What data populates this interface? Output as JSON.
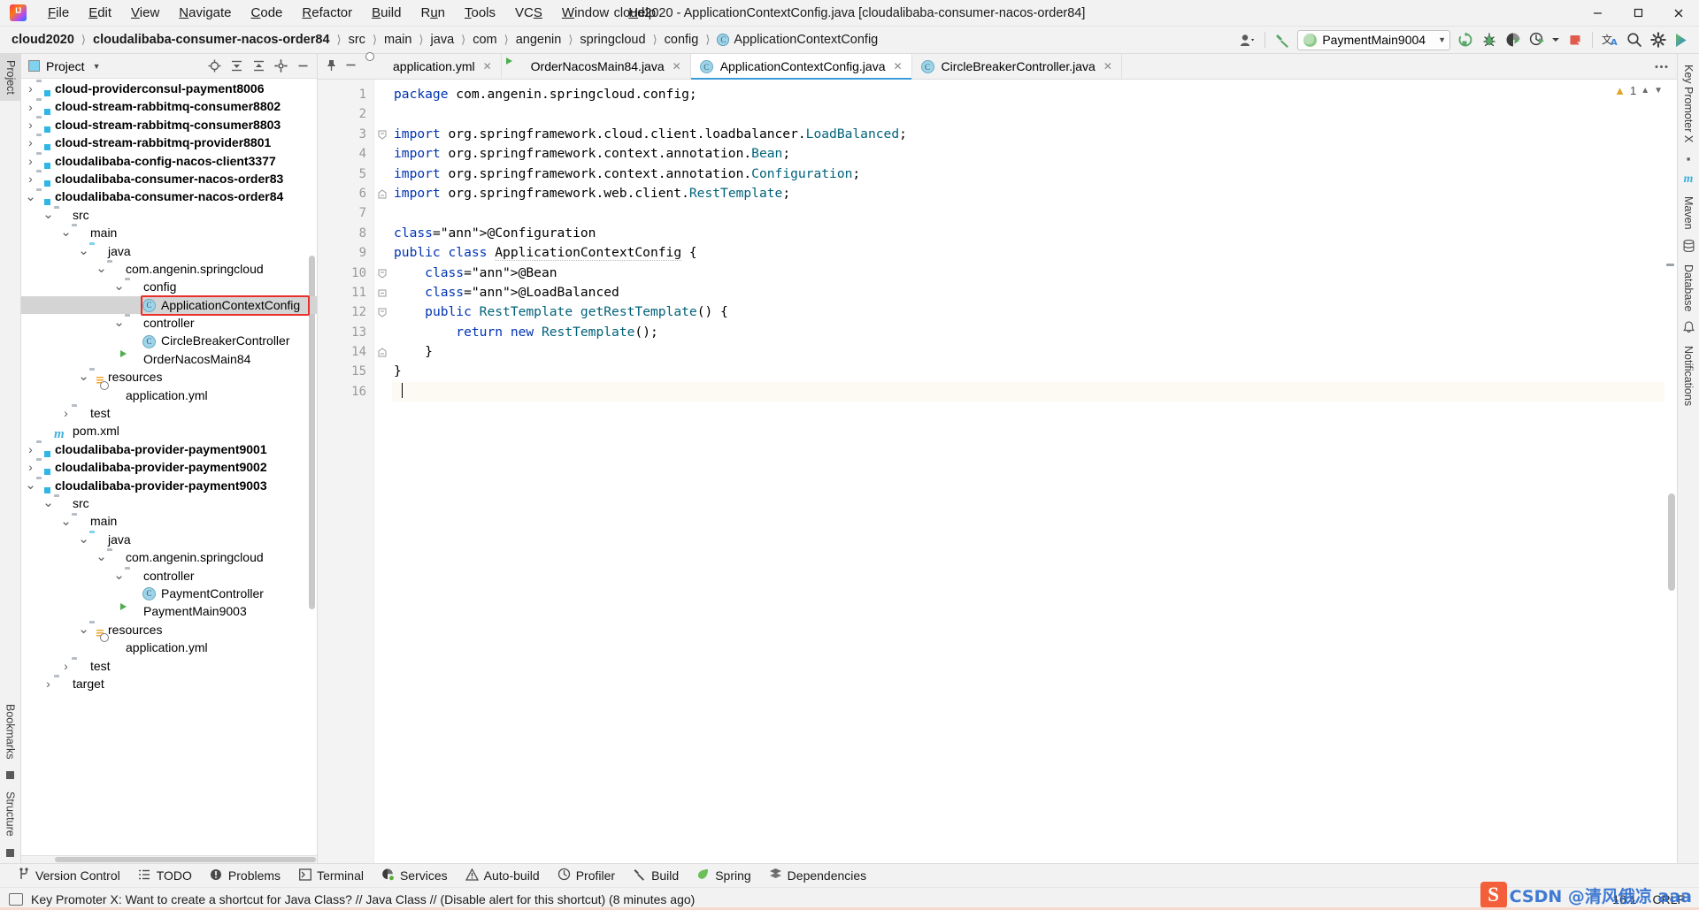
{
  "window": {
    "title": "cloud2020 - ApplicationContextConfig.java [cloudalibaba-consumer-nacos-order84]",
    "logo_text": "IJ",
    "controls": {
      "minimize": "─",
      "maximize": "☐",
      "close": "✕"
    }
  },
  "menubar": [
    {
      "label": "File"
    },
    {
      "label": "Edit"
    },
    {
      "label": "View"
    },
    {
      "label": "Navigate"
    },
    {
      "label": "Code"
    },
    {
      "label": "Refactor"
    },
    {
      "label": "Build"
    },
    {
      "label": "Run"
    },
    {
      "label": "Tools"
    },
    {
      "label": "VCS"
    },
    {
      "label": "Window"
    },
    {
      "label": "Help"
    }
  ],
  "breadcrumb": [
    {
      "label": "cloud2020",
      "bold": true
    },
    {
      "label": "cloudalibaba-consumer-nacos-order84",
      "bold": true
    },
    {
      "label": "src",
      "bold": false
    },
    {
      "label": "main",
      "bold": false
    },
    {
      "label": "java",
      "bold": false
    },
    {
      "label": "com",
      "bold": false
    },
    {
      "label": "angenin",
      "bold": false
    },
    {
      "label": "springcloud",
      "bold": false
    },
    {
      "label": "config",
      "bold": false
    },
    {
      "label": "ApplicationContextConfig",
      "bold": false,
      "icon": "class-icon"
    }
  ],
  "toolbar": {
    "run_config": "PaymentMain9004",
    "icons": [
      "user-account-icon",
      "build-hammer-icon",
      "rerun-icon",
      "debug-icon",
      "coverage-icon",
      "profile-run-icon",
      "stop-icon",
      "translate-icon",
      "search-everywhere-icon",
      "settings-gear-icon",
      "ide-assistant-icon"
    ]
  },
  "left_rail": {
    "tabs": [
      "Project",
      "Bookmarks",
      "Structure"
    ]
  },
  "right_rail": {
    "tabs": [
      "Key Promoter X",
      "Maven",
      "Database",
      "Notifications"
    ]
  },
  "project_panel": {
    "title": "Project",
    "actions": [
      "target-locate-icon",
      "collapse-all-icon",
      "expand-all-icon",
      "settings-gear-icon",
      "hide-icon"
    ],
    "tree": [
      {
        "depth": 1,
        "arrow": "›",
        "icon": "module-icon",
        "label": "cloud-providerconsul-payment8006",
        "bold": true
      },
      {
        "depth": 1,
        "arrow": "›",
        "icon": "module-icon",
        "label": "cloud-stream-rabbitmq-consumer8802",
        "bold": true
      },
      {
        "depth": 1,
        "arrow": "›",
        "icon": "module-icon",
        "label": "cloud-stream-rabbitmq-consumer8803",
        "bold": true
      },
      {
        "depth": 1,
        "arrow": "›",
        "icon": "module-icon",
        "label": "cloud-stream-rabbitmq-provider8801",
        "bold": true
      },
      {
        "depth": 1,
        "arrow": "›",
        "icon": "module-icon",
        "label": "cloudalibaba-config-nacos-client3377",
        "bold": true
      },
      {
        "depth": 1,
        "arrow": "›",
        "icon": "module-icon",
        "label": "cloudalibaba-consumer-nacos-order83",
        "bold": true
      },
      {
        "depth": 1,
        "arrow": "⌄",
        "icon": "module-icon",
        "label": "cloudalibaba-consumer-nacos-order84",
        "bold": true
      },
      {
        "depth": 2,
        "arrow": "⌄",
        "icon": "folder-icon",
        "label": "src",
        "bold": false
      },
      {
        "depth": 3,
        "arrow": "⌄",
        "icon": "folder-icon",
        "label": "main",
        "bold": false
      },
      {
        "depth": 4,
        "arrow": "⌄",
        "icon": "folder-source-icon",
        "label": "java",
        "bold": false
      },
      {
        "depth": 5,
        "arrow": "⌄",
        "icon": "package-icon",
        "label": "com.angenin.springcloud",
        "bold": false
      },
      {
        "depth": 6,
        "arrow": "⌄",
        "icon": "package-icon",
        "label": "config",
        "bold": false
      },
      {
        "depth": 7,
        "arrow": "",
        "icon": "class-icon",
        "label": "ApplicationContextConfig",
        "bold": false,
        "selected": true,
        "highlight": true
      },
      {
        "depth": 6,
        "arrow": "⌄",
        "icon": "package-icon",
        "label": "controller",
        "bold": false
      },
      {
        "depth": 7,
        "arrow": "",
        "icon": "class-icon",
        "label": "CircleBreakerController",
        "bold": false
      },
      {
        "depth": 6,
        "arrow": "",
        "icon": "springboot-icon",
        "label": "OrderNacosMain84",
        "bold": false
      },
      {
        "depth": 4,
        "arrow": "⌄",
        "icon": "folder-resource-icon",
        "label": "resources",
        "bold": false
      },
      {
        "depth": 5,
        "arrow": "",
        "icon": "yml-icon",
        "label": "application.yml",
        "bold": false
      },
      {
        "depth": 3,
        "arrow": "›",
        "icon": "folder-icon",
        "label": "test",
        "bold": false
      },
      {
        "depth": 2,
        "arrow": "",
        "icon": "maven-icon",
        "label": "pom.xml",
        "bold": false
      },
      {
        "depth": 1,
        "arrow": "›",
        "icon": "module-icon",
        "label": "cloudalibaba-provider-payment9001",
        "bold": true
      },
      {
        "depth": 1,
        "arrow": "›",
        "icon": "module-icon",
        "label": "cloudalibaba-provider-payment9002",
        "bold": true
      },
      {
        "depth": 1,
        "arrow": "⌄",
        "icon": "module-icon",
        "label": "cloudalibaba-provider-payment9003",
        "bold": true
      },
      {
        "depth": 2,
        "arrow": "⌄",
        "icon": "folder-icon",
        "label": "src",
        "bold": false
      },
      {
        "depth": 3,
        "arrow": "⌄",
        "icon": "folder-icon",
        "label": "main",
        "bold": false
      },
      {
        "depth": 4,
        "arrow": "⌄",
        "icon": "folder-source-icon",
        "label": "java",
        "bold": false
      },
      {
        "depth": 5,
        "arrow": "⌄",
        "icon": "package-icon",
        "label": "com.angenin.springcloud",
        "bold": false
      },
      {
        "depth": 6,
        "arrow": "⌄",
        "icon": "package-icon",
        "label": "controller",
        "bold": false
      },
      {
        "depth": 7,
        "arrow": "",
        "icon": "class-icon",
        "label": "PaymentController",
        "bold": false
      },
      {
        "depth": 6,
        "arrow": "",
        "icon": "springboot-icon",
        "label": "PaymentMain9003",
        "bold": false
      },
      {
        "depth": 4,
        "arrow": "⌄",
        "icon": "folder-resource-icon",
        "label": "resources",
        "bold": false
      },
      {
        "depth": 5,
        "arrow": "",
        "icon": "yml-icon",
        "label": "application.yml",
        "bold": false
      },
      {
        "depth": 3,
        "arrow": "›",
        "icon": "folder-icon",
        "label": "test",
        "bold": false
      },
      {
        "depth": 2,
        "arrow": "›",
        "icon": "folder-icon",
        "label": "target",
        "bold": false
      }
    ]
  },
  "editor": {
    "tabs": [
      {
        "label": "application.yml",
        "icon": "yml-icon",
        "active": false
      },
      {
        "label": "OrderNacosMain84.java",
        "icon": "springboot-icon",
        "active": false
      },
      {
        "label": "ApplicationContextConfig.java",
        "icon": "class-icon",
        "active": true
      },
      {
        "label": "CircleBreakerController.java",
        "icon": "class-icon",
        "active": false
      }
    ],
    "inspection": {
      "count": "1",
      "icon": "warning-icon"
    },
    "lines": [
      {
        "n": "1",
        "gmark": "",
        "fold": "",
        "text": "package com.angenin.springcloud.config;"
      },
      {
        "n": "2",
        "gmark": "",
        "fold": "",
        "text": ""
      },
      {
        "n": "3",
        "gmark": "",
        "fold": "collapse-top",
        "text": "import org.springframework.cloud.client.loadbalancer.LoadBalanced;"
      },
      {
        "n": "4",
        "gmark": "",
        "fold": "",
        "text": "import org.springframework.context.annotation.Bean;"
      },
      {
        "n": "5",
        "gmark": "",
        "fold": "",
        "text": "import org.springframework.context.annotation.Configuration;"
      },
      {
        "n": "6",
        "gmark": "",
        "fold": "collapse-bottom",
        "text": "import org.springframework.web.client.RestTemplate;"
      },
      {
        "n": "7",
        "gmark": "",
        "fold": "",
        "text": ""
      },
      {
        "n": "8",
        "gmark": "",
        "fold": "",
        "text": "@Configuration"
      },
      {
        "n": "9",
        "gmark": "spring-bean-icon",
        "fold": "",
        "text": "public class ApplicationContextConfig {"
      },
      {
        "n": "10",
        "gmark": "spring-bean-nav-icon",
        "fold": "collapse-top",
        "text": "    @Bean"
      },
      {
        "n": "11",
        "gmark": "",
        "fold": "collapse-mid",
        "text": "    @LoadBalanced"
      },
      {
        "n": "12",
        "gmark": "",
        "fold": "collapse-top",
        "text": "    public RestTemplate getRestTemplate() {"
      },
      {
        "n": "13",
        "gmark": "",
        "fold": "",
        "text": "        return new RestTemplate();"
      },
      {
        "n": "14",
        "gmark": "",
        "fold": "collapse-bottom",
        "text": "    }"
      },
      {
        "n": "15",
        "gmark": "",
        "fold": "",
        "text": "}"
      },
      {
        "n": "16",
        "gmark": "",
        "fold": "",
        "text": "",
        "current": true
      }
    ]
  },
  "bottom_tabs": [
    {
      "label": "Version Control",
      "icon": "branch-icon"
    },
    {
      "label": "TODO",
      "icon": "todo-list-icon"
    },
    {
      "label": "Problems",
      "icon": "problems-icon"
    },
    {
      "label": "Terminal",
      "icon": "terminal-icon"
    },
    {
      "label": "Services",
      "icon": "services-icon"
    },
    {
      "label": "Auto-build",
      "icon": "auto-build-warning-icon"
    },
    {
      "label": "Profiler",
      "icon": "profiler-icon"
    },
    {
      "label": "Build",
      "icon": "build-hammer-icon"
    },
    {
      "label": "Spring",
      "icon": "spring-leaf-icon"
    },
    {
      "label": "Dependencies",
      "icon": "dependencies-icon"
    }
  ],
  "statusbar": {
    "message": "Key Promoter X: Want to create a shortcut for Java Class? // Java Class // (Disable alert for this shortcut) (8 minutes ago)",
    "caret_position": "16:1",
    "line_separator": "CRLF",
    "watermark_logo": "S",
    "watermark_text": "CSDN @清风俄凉 aaa"
  },
  "colors": {
    "accent_blue": "#3b9bd8",
    "keyword_blue": "#0033b3",
    "annotation_gold": "#9e880d",
    "method_teal": "#00627a",
    "selection_gray": "#d4d4d4",
    "highlight_red": "#e8302a",
    "panel_bg": "#f2f2f2",
    "editor_bg": "#ffffff"
  }
}
